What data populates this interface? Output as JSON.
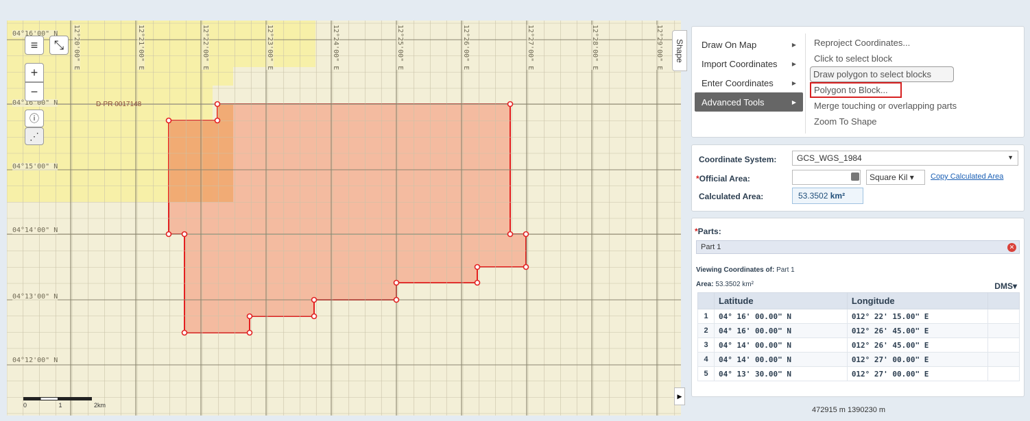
{
  "map": {
    "lat_labels": [
      "04°16'00\" N",
      "04°15'00\" N",
      "04°14'00\" N",
      "04°13'00\" N",
      "04°12'00\" N"
    ],
    "lon_labels": [
      "12°20'00\" E",
      "12°21'00\" E",
      "12°22'00\" E",
      "12°23'00\" E",
      "12°24'00\" E",
      "12°25'00\" E",
      "12°26'00\" E",
      "12°27'00\" E",
      "12°28'00\" E",
      "12°29'00\" E"
    ],
    "block_label": "D-PR 0017148",
    "scale": {
      "left": "0",
      "mid": "1",
      "right": "2km"
    },
    "controls": {
      "menu": "≡",
      "fullscreen": "⤡",
      "zoom_in": "+",
      "zoom_out": "−",
      "info": "ⓘ",
      "select": "⋰"
    },
    "colors": {
      "yellow_block": "#f7f0a0",
      "polygon_fill": "#f4a98e",
      "polygon_stroke": "#e32020",
      "overlap": "#f0a76a"
    }
  },
  "shape_tab": "Shape",
  "collapse_arrow": "▶",
  "menu": {
    "items": [
      {
        "label": "Draw On Map",
        "arrow": "▶"
      },
      {
        "label": "Import Coordinates",
        "arrow": "▶"
      },
      {
        "label": "Enter Coordinates",
        "arrow": "▶"
      },
      {
        "label": "Advanced Tools",
        "arrow": "▶"
      }
    ],
    "sub_items": [
      "Reproject Coordinates...",
      "Click to select block",
      "Draw polygon to select blocks",
      "Polygon to Block...",
      "Merge touching or overlapping parts",
      "Zoom To Shape"
    ]
  },
  "coords": {
    "system_label": "Coordinate System:",
    "system_value": "GCS_WGS_1984",
    "official_label": "Official Area:",
    "official_required": "*",
    "unit_value": "Square Kil ▾",
    "copy_link": "Copy Calculated Area",
    "calc_label": "Calculated Area:",
    "calc_value": "53.3502",
    "calc_unit": "km²",
    "select_arrow": "▼"
  },
  "parts": {
    "required": "*",
    "title": "Parts:",
    "part_name": "Part 1",
    "remove_icon": "✕",
    "viewing_label": "Viewing Coordinates of:",
    "viewing_value": "Part 1",
    "area_label": "Area:",
    "area_value": "53.3502 km²",
    "format": "DMS▾",
    "headers": {
      "lat": "Latitude",
      "lon": "Longitude"
    },
    "rows": [
      {
        "n": "1",
        "lat": "04°  16'  00.00\"  N",
        "lon": "012°  22'  15.00\"  E"
      },
      {
        "n": "2",
        "lat": "04°  16'  00.00\"  N",
        "lon": "012°  26'  45.00\"  E"
      },
      {
        "n": "3",
        "lat": "04°  14'  00.00\"  N",
        "lon": "012°  26'  45.00\"  E"
      },
      {
        "n": "4",
        "lat": "04°  14'  00.00\"  N",
        "lon": "012°  27'  00.00\"  E"
      },
      {
        "n": "5",
        "lat": "04°  13'  30.00\"  N",
        "lon": "012°  27'  00.00\"  E"
      }
    ]
  },
  "status": "472915 m  1390230 m"
}
